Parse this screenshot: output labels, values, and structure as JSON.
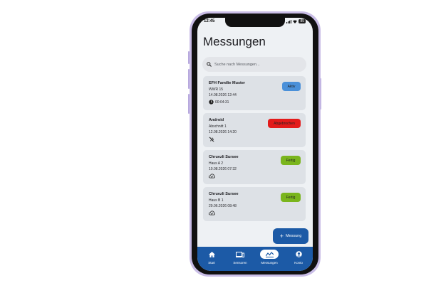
{
  "status": {
    "time": "12:45",
    "battery": "85"
  },
  "page": {
    "title": "Messungen"
  },
  "search": {
    "placeholder": "Suche nach Messungen..."
  },
  "cards": [
    {
      "name": "EFH Familie Muster",
      "sub": "WWR 15",
      "date": "14.08.2026 12:44",
      "meta": "00:04:31",
      "status": "Aktiv",
      "status_color": "#4a90d9"
    },
    {
      "name": "Android",
      "sub": "Abschnitt 1",
      "date": "12.08.2026 14:20",
      "meta": "",
      "status": "Abgebrochen",
      "status_color": "#e31b1b"
    },
    {
      "name": "Chruezli Sursee",
      "sub": "Haus A 2",
      "date": "10.08.2026 07:32",
      "meta": "",
      "status": "Fertig",
      "status_color": "#7ab51d"
    },
    {
      "name": "Chruezli Sursee",
      "sub": "Haus B 1",
      "date": "29.06.2026 08:48",
      "meta": "",
      "status": "Fertig",
      "status_color": "#7ab51d"
    }
  ],
  "fab": {
    "label": "Messung"
  },
  "nav": [
    {
      "label": "Start",
      "icon": "home-icon"
    },
    {
      "label": "Sensoren",
      "icon": "devices-icon"
    },
    {
      "label": "Messungen",
      "icon": "chart-icon"
    },
    {
      "label": "Konto",
      "icon": "account-icon"
    }
  ],
  "colors": {
    "primary": "#1c5aa6",
    "frame": "#c9bde6",
    "surface": "#eef1f4",
    "card": "#dde1e6"
  }
}
